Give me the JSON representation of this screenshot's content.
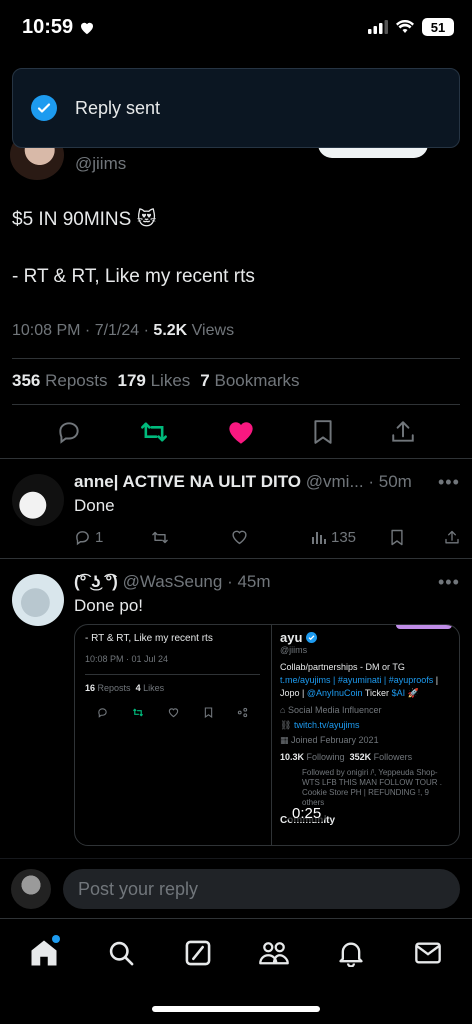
{
  "status_bar": {
    "time": "10:59",
    "battery": "51"
  },
  "toast": {
    "text": "Reply sent"
  },
  "tweet": {
    "handle": "@jiims",
    "text_line1": "$5 IN 90MINS 😻",
    "text_line2": "- RT & RT, Like my recent rts",
    "time": "10:08 PM · 7/1/24 ·",
    "views_count": "5.2K",
    "views_label": "Views",
    "reposts_count": "356",
    "reposts_label": "Reposts",
    "likes_count": "179",
    "likes_label": "Likes",
    "bookmarks_count": "7",
    "bookmarks_label": "Bookmarks"
  },
  "replies": [
    {
      "name": "anne| ACTIVE NA ULIT DITO",
      "handle": "@vmi... · 50m",
      "text": "Done",
      "reply_count": "1",
      "views": "135"
    },
    {
      "name": "(͡° ͜ʖ ͡°)",
      "handle": "@WasSeung · 45m",
      "text": "Done po!",
      "embed": {
        "tweet_text": "- RT & RT, Like my recent rts",
        "tweet_time": "10:08 PM · 01 Jul 24",
        "reposts_count": "16",
        "reposts_label": "Reposts",
        "likes_count": "4",
        "likes_label": "Likes",
        "profile_name": "ayu",
        "profile_handle": "@jiims",
        "bio_1": "Collab/partnerships - DM or TG",
        "bio_link": "t.me/ayujims",
        "bio_tags": "| #ayuminati | #ayuproofs",
        "bio_2": "| Jopo |",
        "bio_coin": "@AnyInuCoin",
        "bio_3": "Ticker",
        "bio_ai": "$AI",
        "category": "Social Media Influencer",
        "link": "twitch.tv/ayujims",
        "joined": "Joined February 2021",
        "following_count": "10.3K",
        "following_label": "Following",
        "followers_count": "352K",
        "followers_label": "Followers",
        "followed_by": "Followed by onigiri /ˡ, Yeppeuda Shop- WTS LFB THIS MAN FOLLOW TOUR . Cookie Store PH | REFUNDING !, 9 others",
        "section": "Community",
        "video_time": "0:25"
      }
    }
  ],
  "composer": {
    "placeholder": "Post your reply"
  },
  "colors": {
    "accent": "#1d9bf0",
    "repost_green": "#00ba7c",
    "like_pink": "#f91880"
  }
}
